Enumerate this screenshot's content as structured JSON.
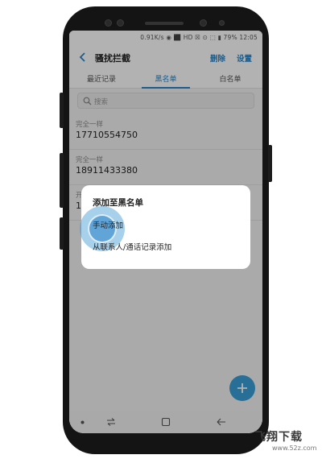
{
  "status_bar": {
    "text": "0.91K/s ◉ ⬛ HD ☒ ⊙ ⬚ ▮ 79% 12:05",
    "battery_percent": "79%",
    "time": "12:05"
  },
  "app_bar": {
    "back_icon": "chevron-left-icon",
    "title": "骚扰拦截",
    "delete_label": "删除",
    "settings_label": "设置"
  },
  "tabs": [
    {
      "label": "最近记录",
      "active": false
    },
    {
      "label": "黑名单",
      "active": true
    },
    {
      "label": "白名单",
      "active": false
    }
  ],
  "search": {
    "placeholder": "搜索",
    "icon": "search-icon"
  },
  "blacklist": [
    {
      "match_type": "完全一样",
      "number": "17710554750"
    },
    {
      "match_type": "完全一样",
      "number": "18911433380"
    },
    {
      "match_type": "开",
      "number": "1"
    }
  ],
  "fab": {
    "icon": "plus-icon"
  },
  "dialog": {
    "title": "添加至黑名单",
    "options": [
      "手动添加",
      "从联系人/通话记录添加"
    ]
  },
  "nav_bar": {
    "icons": [
      "dot-icon",
      "recents-icon",
      "home-icon",
      "back-icon"
    ]
  },
  "watermark": {
    "main": "飞翔下载",
    "sub": "www.52z.com"
  },
  "colors": {
    "accent": "#2a86c8",
    "fab": "#3a9fd8",
    "phone_body": "#141414"
  }
}
